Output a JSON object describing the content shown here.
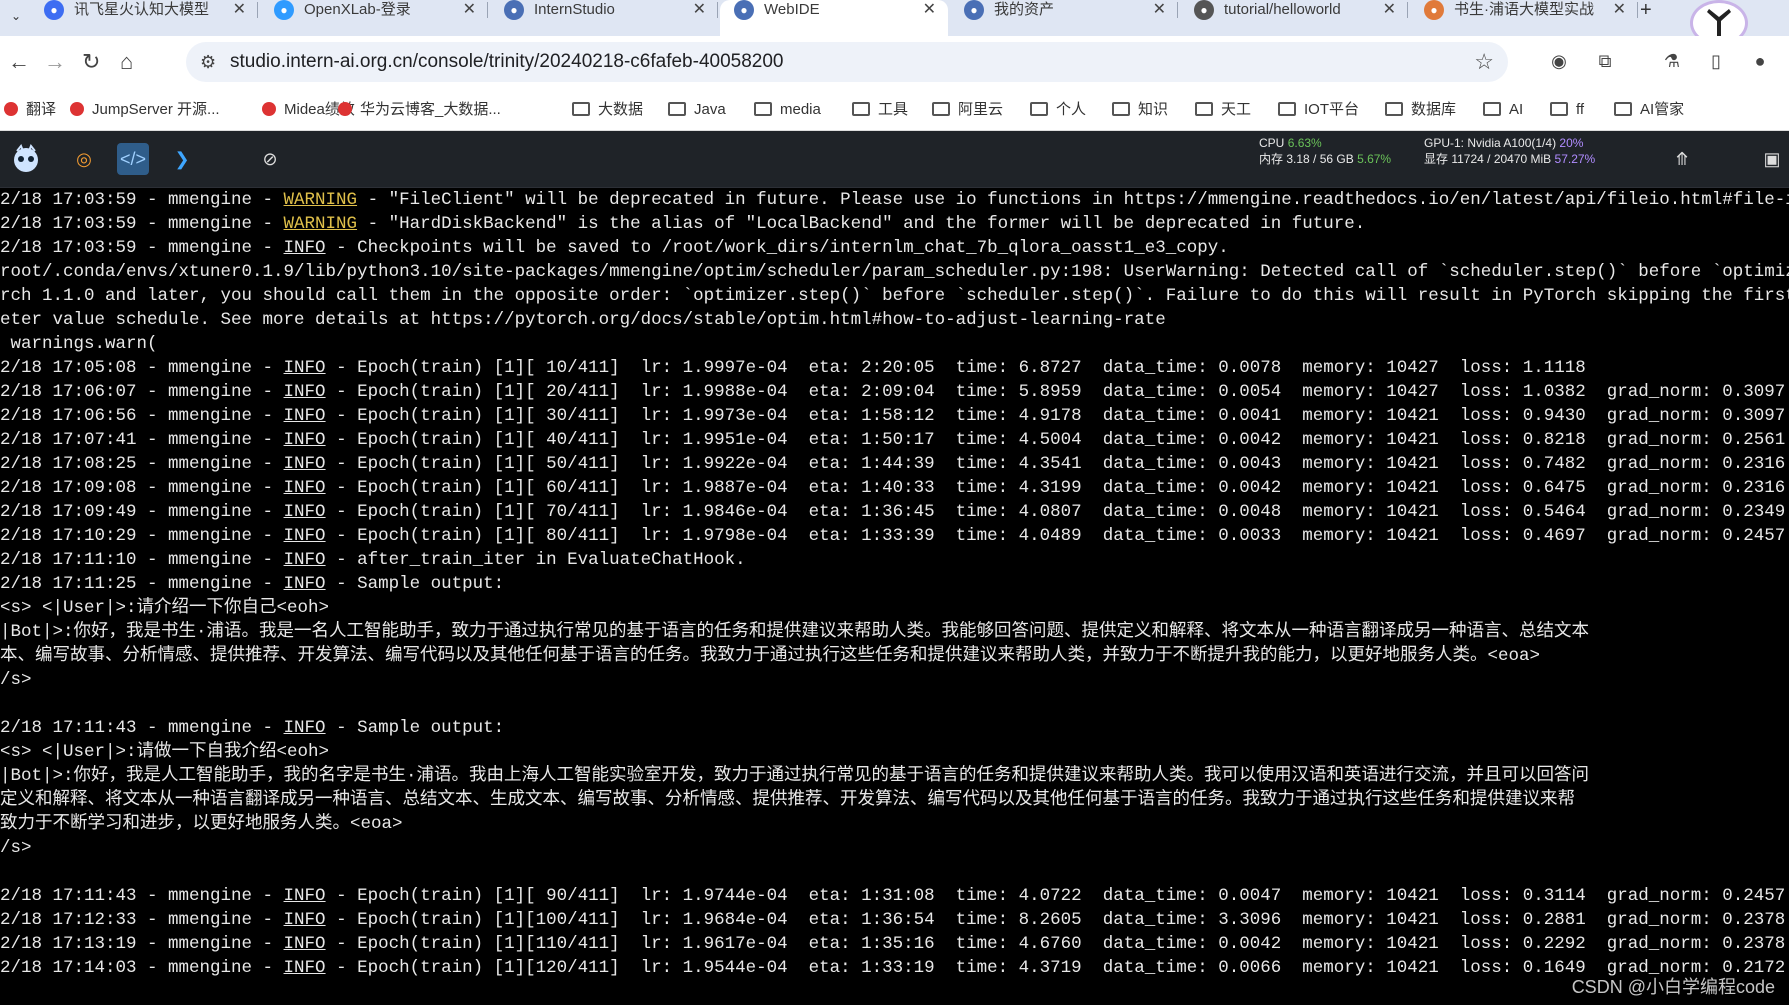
{
  "browser": {
    "tabs": [
      {
        "label": "讯飞星火认知大模型",
        "active": false
      },
      {
        "label": "OpenXLab-登录",
        "active": false
      },
      {
        "label": "InternStudio",
        "active": false
      },
      {
        "label": "WebIDE",
        "active": true
      },
      {
        "label": "我的资产",
        "active": false
      },
      {
        "label": "tutorial/helloworld",
        "active": false
      },
      {
        "label": "书生·浦语大模型实战",
        "active": false
      }
    ],
    "url": "studio.intern-ai.org.cn/console/trinity/20240218-c6fafeb-40058200",
    "bookmarks": [
      {
        "label": "翻译",
        "type": "link"
      },
      {
        "label": "JumpServer 开源...",
        "type": "link"
      },
      {
        "label": "Midea绩效",
        "type": "link"
      },
      {
        "label": "华为云博客_大数据...",
        "type": "link"
      },
      {
        "label": "大数据",
        "type": "folder"
      },
      {
        "label": "Java",
        "type": "folder"
      },
      {
        "label": "media",
        "type": "folder"
      },
      {
        "label": "工具",
        "type": "folder"
      },
      {
        "label": "阿里云",
        "type": "folder"
      },
      {
        "label": "个人",
        "type": "folder"
      },
      {
        "label": "知识",
        "type": "folder"
      },
      {
        "label": "天工",
        "type": "folder"
      },
      {
        "label": "IOT平台",
        "type": "folder"
      },
      {
        "label": "数据库",
        "type": "folder"
      },
      {
        "label": "AI",
        "type": "folder"
      },
      {
        "label": "ff",
        "type": "folder"
      },
      {
        "label": "AI管家",
        "type": "folder"
      }
    ]
  },
  "ide": {
    "stats": {
      "cpu_label": "CPU",
      "cpu_value": "6.63%",
      "mem_label": "内存 3.18 / 56 GB",
      "mem_value": "5.67%",
      "gpu_label": "GPU-1: Nvidia A100(1/4)",
      "gpu_value": "20%",
      "vram_label": "显存 11724 / 20470 MiB",
      "vram_value": "57.27%"
    }
  },
  "terminal": {
    "lines": [
      {
        "pre": "2/18 17:03:59 - mmengine - ",
        "level": "WARNING",
        "post": " - \"FileClient\" will be deprecated in future. Please use io functions in https://mmengine.readthedocs.io/en/latest/api/fileio.html#file-io"
      },
      {
        "pre": "2/18 17:03:59 - mmengine - ",
        "level": "WARNING",
        "post": " - \"HardDiskBackend\" is the alias of \"LocalBackend\" and the former will be deprecated in future."
      },
      {
        "pre": "2/18 17:03:59 - mmengine - ",
        "level": "INFO",
        "post": " - Checkpoints will be saved to /root/work_dirs/internlm_chat_7b_qlora_oasst1_e3_copy."
      },
      {
        "pre": "root/.conda/envs/xtuner0.1.9/lib/python3.10/site-packages/mmengine/optim/scheduler/param_scheduler.py:198: UserWarning: Detected call of `scheduler.step()` before `optimizer.step()`",
        "level": "",
        "post": ""
      },
      {
        "pre": "rch 1.1.0 and later, you should call them in the opposite order: `optimizer.step()` before `scheduler.step()`. Failure to do this will result in PyTorch skipping the first value of",
        "level": "",
        "post": ""
      },
      {
        "pre": "eter value schedule. See more details at https://pytorch.org/docs/stable/optim.html#how-to-adjust-learning-rate",
        "level": "",
        "post": ""
      },
      {
        "pre": " warnings.warn(",
        "level": "",
        "post": ""
      },
      {
        "pre": "2/18 17:05:08 - mmengine - ",
        "level": "INFO",
        "post": " - Epoch(train) [1][ 10/411]  lr: 1.9997e-04  eta: 2:20:05  time: 6.8727  data_time: 0.0078  memory: 10427  loss: 1.1118"
      },
      {
        "pre": "2/18 17:06:07 - mmengine - ",
        "level": "INFO",
        "post": " - Epoch(train) [1][ 20/411]  lr: 1.9988e-04  eta: 2:09:04  time: 5.8959  data_time: 0.0054  memory: 10427  loss: 1.0382  grad_norm: 0.3097"
      },
      {
        "pre": "2/18 17:06:56 - mmengine - ",
        "level": "INFO",
        "post": " - Epoch(train) [1][ 30/411]  lr: 1.9973e-04  eta: 1:58:12  time: 4.9178  data_time: 0.0041  memory: 10421  loss: 0.9430  grad_norm: 0.3097"
      },
      {
        "pre": "2/18 17:07:41 - mmengine - ",
        "level": "INFO",
        "post": " - Epoch(train) [1][ 40/411]  lr: 1.9951e-04  eta: 1:50:17  time: 4.5004  data_time: 0.0042  memory: 10421  loss: 0.8218  grad_norm: 0.2561"
      },
      {
        "pre": "2/18 17:08:25 - mmengine - ",
        "level": "INFO",
        "post": " - Epoch(train) [1][ 50/411]  lr: 1.9922e-04  eta: 1:44:39  time: 4.3541  data_time: 0.0043  memory: 10421  loss: 0.7482  grad_norm: 0.2316"
      },
      {
        "pre": "2/18 17:09:08 - mmengine - ",
        "level": "INFO",
        "post": " - Epoch(train) [1][ 60/411]  lr: 1.9887e-04  eta: 1:40:33  time: 4.3199  data_time: 0.0042  memory: 10421  loss: 0.6475  grad_norm: 0.2316"
      },
      {
        "pre": "2/18 17:09:49 - mmengine - ",
        "level": "INFO",
        "post": " - Epoch(train) [1][ 70/411]  lr: 1.9846e-04  eta: 1:36:45  time: 4.0807  data_time: 0.0048  memory: 10421  loss: 0.5464  grad_norm: 0.2349"
      },
      {
        "pre": "2/18 17:10:29 - mmengine - ",
        "level": "INFO",
        "post": " - Epoch(train) [1][ 80/411]  lr: 1.9798e-04  eta: 1:33:39  time: 4.0489  data_time: 0.0033  memory: 10421  loss: 0.4697  grad_norm: 0.2457"
      },
      {
        "pre": "2/18 17:11:10 - mmengine - ",
        "level": "INFO",
        "post": " - after_train_iter in EvaluateChatHook."
      },
      {
        "pre": "2/18 17:11:25 - mmengine - ",
        "level": "INFO",
        "post": " - Sample output:"
      },
      {
        "pre": "<s> <|User|>:请介绍一下你自己<eoh>",
        "level": "",
        "post": ""
      },
      {
        "pre": "|Bot|>:你好，我是书生·浦语。我是一名人工智能助手，致力于通过执行常见的基于语言的任务和提供建议来帮助人类。我能够回答问题、提供定义和解释、将文本从一种语言翻译成另一种语言、总结文本",
        "level": "",
        "post": ""
      },
      {
        "pre": "本、编写故事、分析情感、提供推荐、开发算法、编写代码以及其他任何基于语言的任务。我致力于通过执行这些任务和提供建议来帮助人类，并致力于不断提升我的能力，以更好地服务人类。<eoa>",
        "level": "",
        "post": ""
      },
      {
        "pre": "/s>",
        "level": "",
        "post": ""
      },
      {
        "pre": "",
        "level": "",
        "post": ""
      },
      {
        "pre": "2/18 17:11:43 - mmengine - ",
        "level": "INFO",
        "post": " - Sample output:"
      },
      {
        "pre": "<s> <|User|>:请做一下自我介绍<eoh>",
        "level": "",
        "post": ""
      },
      {
        "pre": "|Bot|>:你好，我是人工智能助手，我的名字是书生·浦语。我由上海人工智能实验室开发，致力于通过执行常见的基于语言的任务和提供建议来帮助人类。我可以使用汉语和英语进行交流，并且可以回答问",
        "level": "",
        "post": ""
      },
      {
        "pre": "定义和解释、将文本从一种语言翻译成另一种语言、总结文本、生成文本、编写故事、分析情感、提供推荐、开发算法、编写代码以及其他任何基于语言的任务。我致力于通过执行这些任务和提供建议来帮",
        "level": "",
        "post": ""
      },
      {
        "pre": "致力于不断学习和进步，以更好地服务人类。<eoa>",
        "level": "",
        "post": ""
      },
      {
        "pre": "/s>",
        "level": "",
        "post": ""
      },
      {
        "pre": "",
        "level": "",
        "post": ""
      },
      {
        "pre": "2/18 17:11:43 - mmengine - ",
        "level": "INFO",
        "post": " - Epoch(train) [1][ 90/411]  lr: 1.9744e-04  eta: 1:31:08  time: 4.0722  data_time: 0.0047  memory: 10421  loss: 0.3114  grad_norm: 0.2457"
      },
      {
        "pre": "2/18 17:12:33 - mmengine - ",
        "level": "INFO",
        "post": " - Epoch(train) [1][100/411]  lr: 1.9684e-04  eta: 1:36:54  time: 8.2605  data_time: 3.3096  memory: 10421  loss: 0.2881  grad_norm: 0.2378"
      },
      {
        "pre": "2/18 17:13:19 - mmengine - ",
        "level": "INFO",
        "post": " - Epoch(train) [1][110/411]  lr: 1.9617e-04  eta: 1:35:16  time: 4.6760  data_time: 0.0042  memory: 10421  loss: 0.2292  grad_norm: 0.2378"
      },
      {
        "pre": "2/18 17:14:03 - mmengine - ",
        "level": "INFO",
        "post": " - Epoch(train) [1][120/411]  lr: 1.9544e-04  eta: 1:33:19  time: 4.3719  data_time: 0.0066  memory: 10421  loss: 0.1649  grad_norm: 0.2172"
      }
    ]
  },
  "watermark": "CSDN @小白学编程code"
}
